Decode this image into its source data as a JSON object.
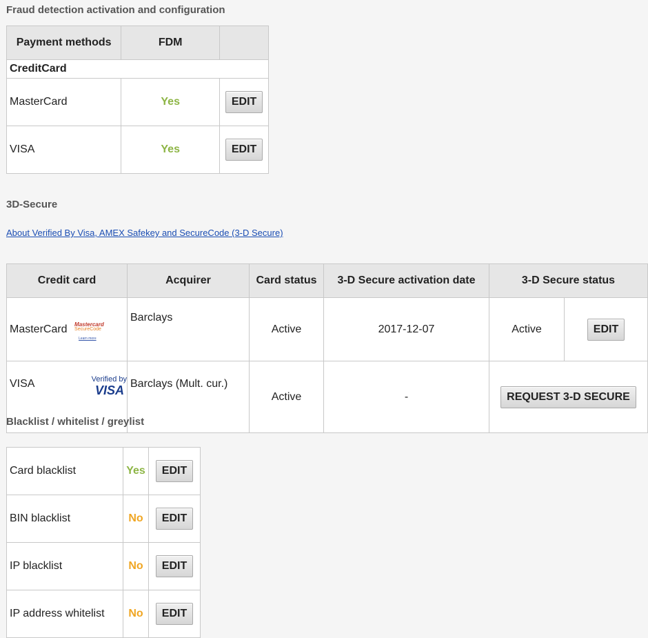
{
  "sections": {
    "fraud_title": "Fraud detection activation and configuration",
    "tds_title": "3D-Secure",
    "tds_link": "About Verified By Visa, AMEX Safekey and SecureCode (3-D Secure)",
    "lists_title": "Blacklist / whitelist / greylist"
  },
  "fdm": {
    "headers": [
      "Payment methods",
      "FDM",
      ""
    ],
    "group": "CreditCard",
    "rows": [
      {
        "method": "MasterCard",
        "status": "Yes",
        "action": "EDIT"
      },
      {
        "method": "VISA",
        "status": "Yes",
        "action": "EDIT"
      }
    ]
  },
  "tds": {
    "headers": [
      "Credit card",
      "Acquirer",
      "Card status",
      "3-D Secure activation date",
      "3-D Secure status"
    ],
    "rows": [
      {
        "card": "MasterCard",
        "logo_line1": "Mastercard",
        "logo_line2": "SecureCode",
        "logo_line3": "Learn more",
        "acquirer": "Barclays",
        "card_status": "Active",
        "date": "2017-12-07",
        "tds_status": "Active",
        "action": "EDIT"
      },
      {
        "card": "VISA",
        "logo_line1": "Verified by",
        "logo_line2": "VISA",
        "acquirer": "Barclays (Mult. cur.)",
        "card_status": "Active",
        "date": "-",
        "action": "REQUEST 3-D SECURE"
      }
    ]
  },
  "lists": {
    "rows": [
      {
        "label": "Card blacklist",
        "status": "Yes",
        "action": "EDIT"
      },
      {
        "label": "BIN blacklist",
        "status": "No",
        "action": "EDIT"
      },
      {
        "label": "IP blacklist",
        "status": "No",
        "action": "EDIT"
      },
      {
        "label": "IP address whitelist",
        "status": "No",
        "action": "EDIT"
      }
    ]
  },
  "colors": {
    "yes": "#8db545",
    "no": "#f0a623",
    "link": "#1a4db3"
  }
}
